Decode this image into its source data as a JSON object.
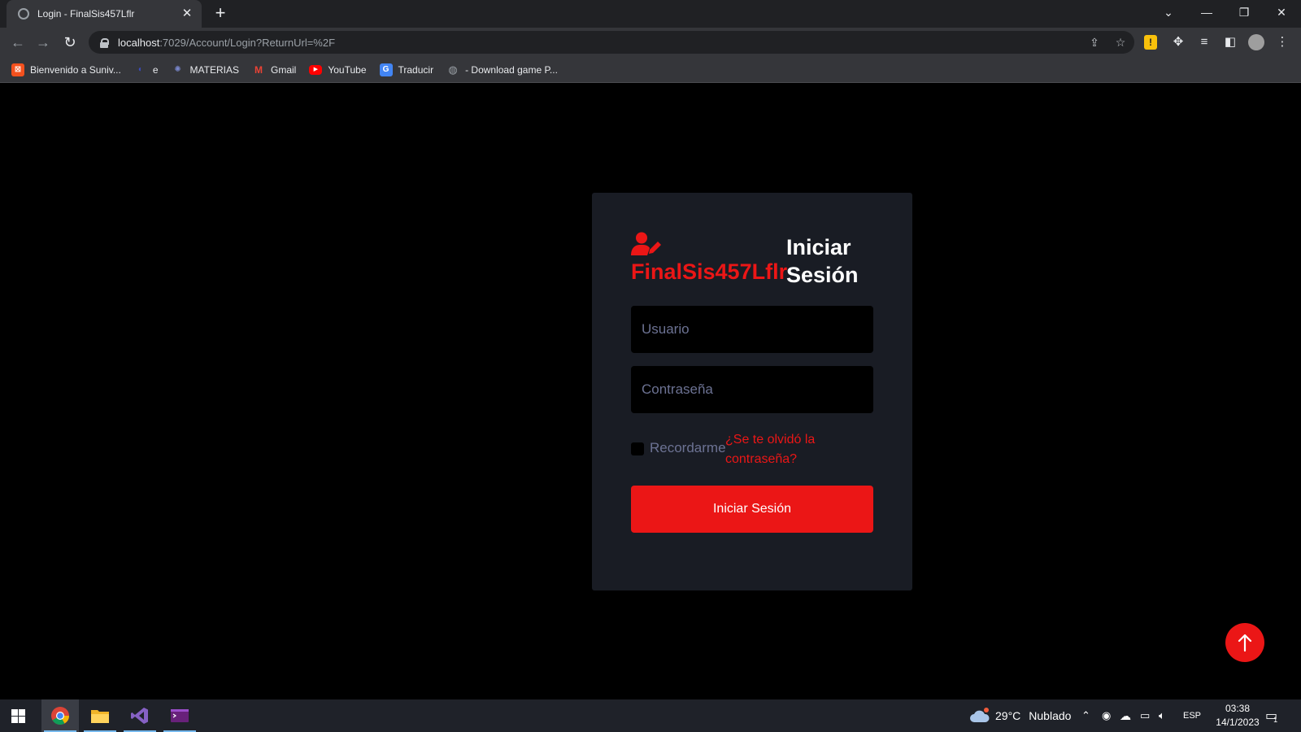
{
  "browser": {
    "tab_title": "Login - FinalSis457Lflr",
    "tab_close": "✕",
    "new_tab": "+",
    "url_host": "localhost",
    "url_path": ":7029/Account/Login?ReturnUrl=%2F"
  },
  "bookmarks": [
    {
      "label": "Bienvenido a Suniv...",
      "icon": "university-favicon",
      "color": "#f4511e"
    },
    {
      "label": "e",
      "icon": "blue-favicon",
      "color": "#3b4cc0"
    },
    {
      "label": "MATERIAS",
      "icon": "materias-favicon",
      "color": "#5c6bc0"
    },
    {
      "label": "Gmail",
      "icon": "gmail-favicon",
      "color": "#ea4335"
    },
    {
      "label": "YouTube",
      "icon": "youtube-favicon",
      "color": "#ff0000"
    },
    {
      "label": "Traducir",
      "icon": "translate-favicon",
      "color": "#4285f4"
    },
    {
      "label": "- Download game P...",
      "icon": "globe-favicon",
      "color": "#9aa0a6"
    }
  ],
  "login": {
    "brand": "FinalSis457Lflr",
    "heading_line1": "Iniciar",
    "heading_line2": "Sesión",
    "username_placeholder": "Usuario",
    "password_placeholder": "Contraseña",
    "remember_label": "Recordarme",
    "forgot_link": "¿Se te olvidó la contraseña?",
    "submit_label": "Iniciar Sesión"
  },
  "colors": {
    "accent": "#eb1616",
    "card_bg": "#191c24",
    "muted_text": "#6c7293"
  },
  "taskbar": {
    "temperature": "29°C",
    "weather": "Nublado",
    "language": "ESP",
    "time": "03:38",
    "date": "14/1/2023",
    "notification_count": "1"
  }
}
